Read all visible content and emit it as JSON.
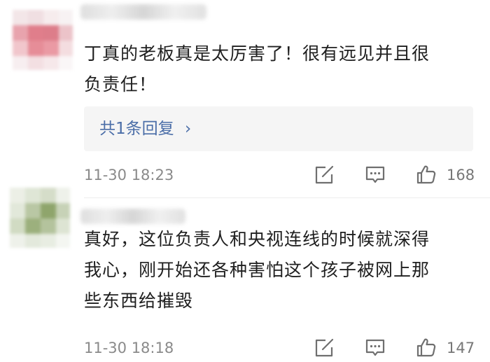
{
  "comments": [
    {
      "text": "丁真的老板真是太厉害了！很有远见并且很\n负责任！",
      "reply_link": "共1条回复",
      "timestamp": "11-30 18:23",
      "likes": "168"
    },
    {
      "text": "真好，这位负责人和央视连线的时候就深得\n我心，刚开始还各种害怕这个孩子被网上那\n些东西给摧毁",
      "timestamp": "11-30 18:18",
      "likes": "147"
    }
  ],
  "reply_chevron": "›",
  "icons": {
    "share": "share-icon",
    "comment": "comment-icon",
    "like": "thumbs-up-icon"
  }
}
